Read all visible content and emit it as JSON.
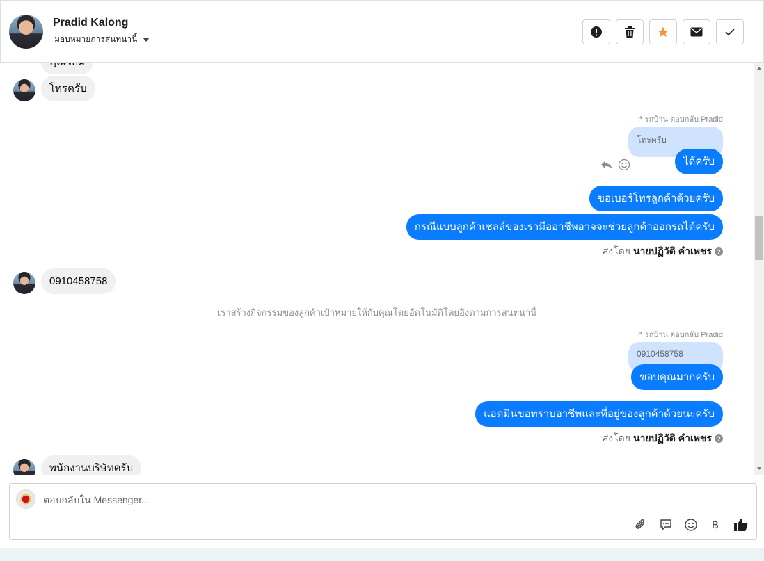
{
  "header": {
    "contact_name": "Pradid Kalong",
    "assign_label": "มอบหมายการสนทนานี้",
    "actions": [
      {
        "name": "spam",
        "icon": "exclamation-icon"
      },
      {
        "name": "delete",
        "icon": "trash-icon"
      },
      {
        "name": "star",
        "icon": "star-icon",
        "color": "#f5923e"
      },
      {
        "name": "mark-unread",
        "icon": "envelope-icon"
      },
      {
        "name": "done",
        "icon": "check-icon"
      }
    ]
  },
  "thread": {
    "partial_top_text": "คุณใหม่",
    "msg1": "โทรครับ",
    "reply1_note": "รถบ้าน ตอบกลับ Pradid",
    "reply1_quote": "โทรครับ",
    "reply1_text": "ได้ครับ",
    "out2": "ขอเบอร์โทรลูกค้าด้วยครับ",
    "out3": "กรณีแบบลูกค้าเซลล์ของเรามืออาชีพอาจจะช่วยลูกค้าออกรถได้ครับ",
    "sent_by_label": "ส่งโดย",
    "sent_by_name": "นายปฏิวัติ คำเพชร",
    "msg_phone": "0910458758",
    "system_note": "เราสร้างกิจกรรมของลูกค้าเป้าหมายให้กับคุณโดยอัตโนมัติโดยอิงตามการสนทนานี้",
    "reply2_note": "รถบ้าน ตอบกลับ Pradid",
    "reply2_quote": "0910458758",
    "reply2_text": "ขอบคุณมากครับ",
    "out4": "แอดมินขอทราบอาชีพและที่อยู่ของลูกค้าด้วยนะครับ",
    "sent_by_label2": "ส่งโดย",
    "sent_by_name2": "นายปฏิวัติ คำเพชร",
    "msg_last": "พนักงานบริษัทครับ"
  },
  "composer": {
    "placeholder": "ตอบกลับใน Messenger...",
    "tools": [
      "paperclip-icon",
      "chat-bubble-icon",
      "emoji-icon",
      "baht-icon",
      "thumbs-up-icon"
    ],
    "baht_symbol": "฿"
  },
  "colors": {
    "outgoing": "#0a7cff",
    "incoming": "#f0f0f0",
    "quote": "#cfe3ff",
    "star": "#f5923e"
  }
}
